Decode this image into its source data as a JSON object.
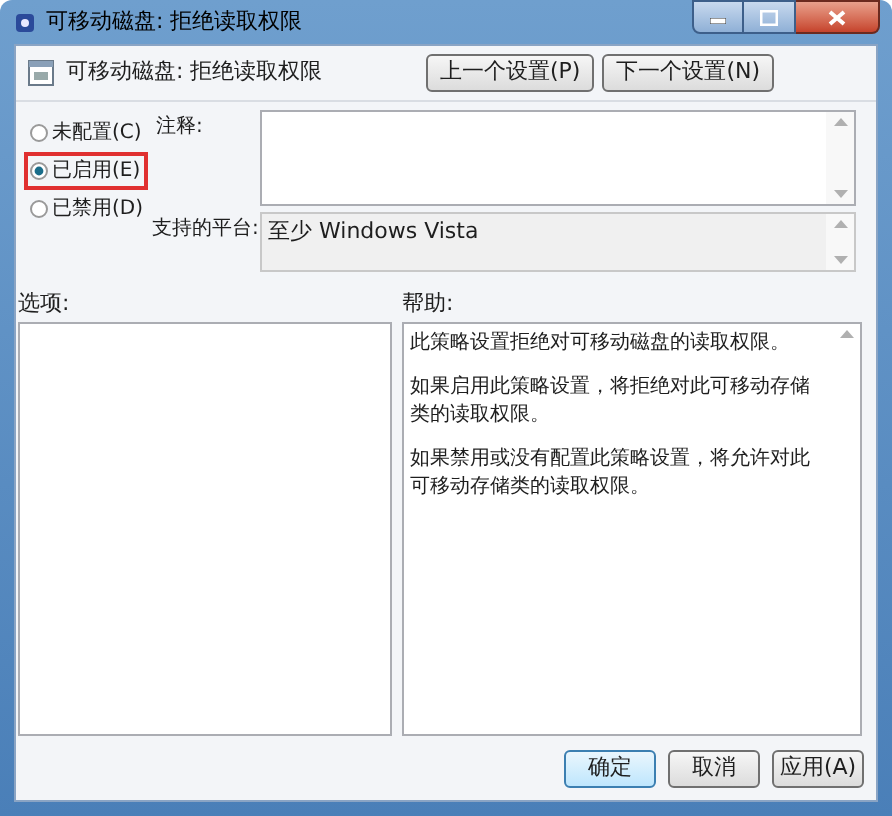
{
  "window": {
    "title": "可移动磁盘: 拒绝读取权限"
  },
  "header": {
    "title": "可移动磁盘: 拒绝读取权限",
    "buttons": [
      {
        "label": "上一个设置(P)"
      },
      {
        "label": "下一个设置(N)"
      }
    ]
  },
  "state_options": [
    {
      "label": "未配置(C)",
      "selected": false
    },
    {
      "label": "已启用(E)",
      "selected": true
    },
    {
      "label": "已禁用(D)",
      "selected": false
    }
  ],
  "comment": {
    "label": "注释:"
  },
  "platform": {
    "label": "支持的平台:",
    "value": "至少 Windows Vista"
  },
  "options": {
    "label": "选项:"
  },
  "help": {
    "label": "帮助:",
    "paragraphs": [
      "此策略设置拒绝对可移动磁盘的读取权限。",
      "如果启用此策略设置，将拒绝对此可移动存储类的读取权限。",
      "如果禁用或没有配置此策略设置，将允许对此可移动存储类的读取权限。"
    ]
  },
  "footer_buttons": [
    {
      "label": "确定",
      "default": true
    },
    {
      "label": "取消",
      "default": false
    },
    {
      "label": "应用(A)",
      "default": false
    }
  ]
}
